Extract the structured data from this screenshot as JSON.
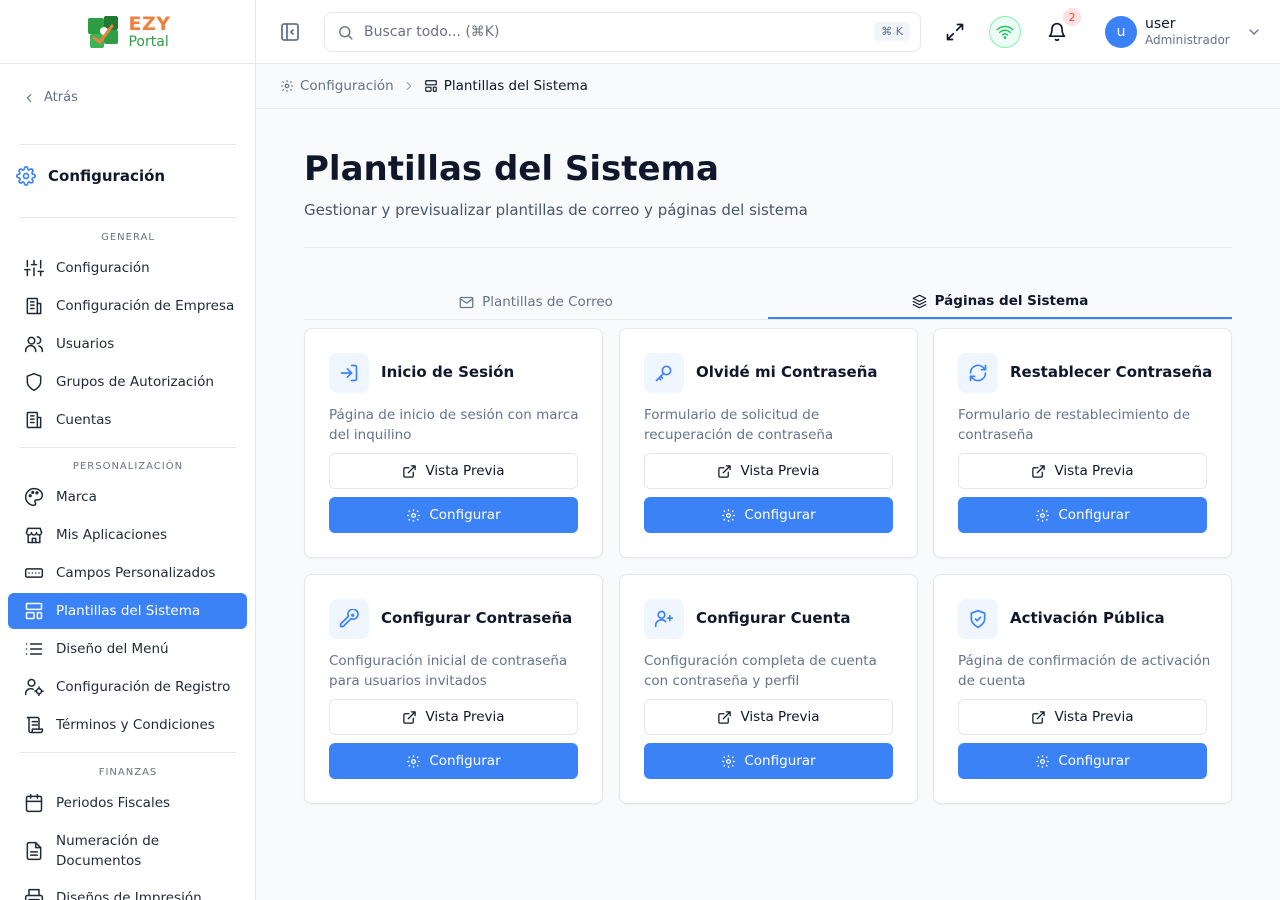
{
  "brand": {
    "name_line1": "EZY",
    "name_line2": "Portal"
  },
  "sidebar": {
    "back_label": "Atrás",
    "section_title": "Configuración",
    "groups": [
      {
        "label": "GENERAL",
        "items": [
          {
            "label": "Configuración",
            "icon": "sliders-icon"
          },
          {
            "label": "Configuración de Empresa",
            "icon": "building-icon"
          },
          {
            "label": "Usuarios",
            "icon": "users-icon"
          },
          {
            "label": "Grupos de Autorización",
            "icon": "shield-icon"
          },
          {
            "label": "Cuentas",
            "icon": "building-icon"
          }
        ]
      },
      {
        "label": "PERSONALIZACIÓN",
        "items": [
          {
            "label": "Marca",
            "icon": "palette-icon"
          },
          {
            "label": "Mis Aplicaciones",
            "icon": "store-icon"
          },
          {
            "label": "Campos Personalizados",
            "icon": "input-field-icon"
          },
          {
            "label": "Plantillas del Sistema",
            "icon": "layout-template-icon",
            "active": true
          },
          {
            "label": "Diseño del Menú",
            "icon": "list-icon"
          },
          {
            "label": "Configuración de Registro",
            "icon": "user-cog-icon"
          },
          {
            "label": "Términos y Condiciones",
            "icon": "scroll-icon"
          }
        ]
      },
      {
        "label": "FINANZAS",
        "items": [
          {
            "label": "Periodos Fiscales",
            "icon": "calendar-icon"
          },
          {
            "label": "Numeración de Documentos",
            "icon": "file-text-icon"
          },
          {
            "label": "Diseños de Impresión",
            "icon": "printer-icon"
          }
        ]
      }
    ]
  },
  "topbar": {
    "search_placeholder": "Buscar todo... (⌘K)",
    "search_shortcut": "⌘ K",
    "notification_count": "2",
    "user": {
      "initial": "u",
      "name": "user",
      "role": "Administrador"
    }
  },
  "breadcrumb": {
    "parent": "Configuración",
    "current": "Plantillas del Sistema"
  },
  "page": {
    "title": "Plantillas del Sistema",
    "subtitle": "Gestionar y previsualizar plantillas de correo y páginas del sistema"
  },
  "tabs": [
    {
      "label": "Plantillas de Correo",
      "icon": "mail-icon",
      "active": false
    },
    {
      "label": "Páginas del Sistema",
      "icon": "layers-icon",
      "active": true
    }
  ],
  "cards": [
    {
      "title": "Inicio de Sesión",
      "description": "Página de inicio de sesión con marca del inquilino",
      "icon": "log-in-icon"
    },
    {
      "title": "Olvidé mi Contraseña",
      "description": "Formulario de solicitud de recuperación de contraseña",
      "icon": "key-icon"
    },
    {
      "title": "Restablecer Contraseña",
      "description": "Formulario de restablecimiento de contraseña",
      "icon": "refresh-icon"
    },
    {
      "title": "Configurar Contraseña",
      "description": "Configuración inicial de contraseña para usuarios invitados",
      "icon": "key-round-icon"
    },
    {
      "title": "Configurar Cuenta",
      "description": "Configuración completa de cuenta con contraseña y perfil",
      "icon": "user-plus-icon"
    },
    {
      "title": "Activación Pública",
      "description": "Página de confirmación de activación de cuenta",
      "icon": "shield-check-icon"
    }
  ],
  "card_actions": {
    "preview_label": "Vista Previa",
    "configure_label": "Configurar"
  },
  "colors": {
    "primary": "#3b82f6",
    "brand_orange": "#f0803c",
    "brand_green": "#2e9e44",
    "text": "#0f172a",
    "muted": "#64748b"
  }
}
